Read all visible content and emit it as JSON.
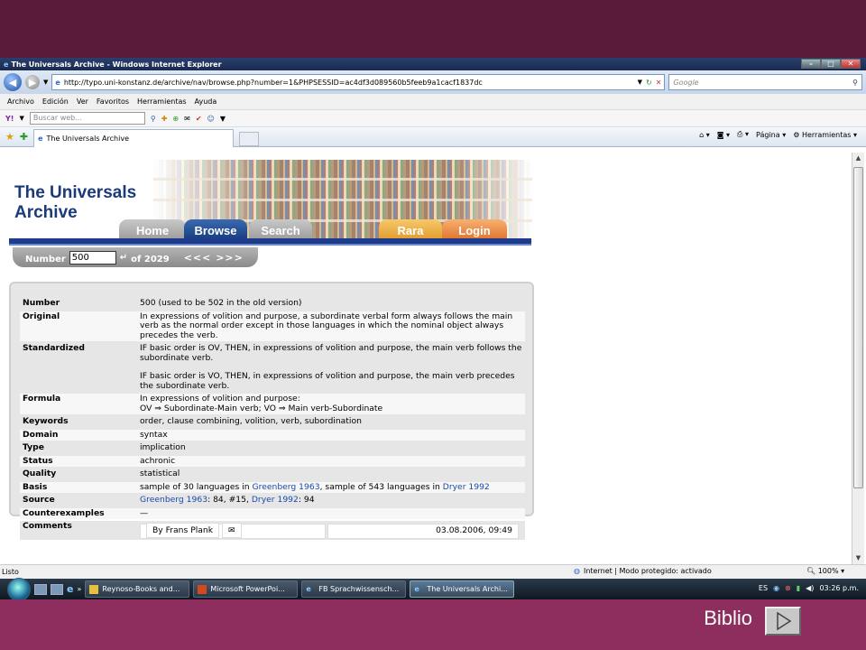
{
  "browser": {
    "window_title": "The Universals Archive - Windows Internet Explorer",
    "url": "http://typo.uni-konstanz.de/archive/nav/browse.php?number=1&PHPSESSID=ac4df3d089560b5feeb9a1cacf1837dc",
    "search_placeholder": "Google",
    "menu": [
      "Archivo",
      "Edición",
      "Ver",
      "Favoritos",
      "Herramientas",
      "Ayuda"
    ],
    "toolbar_search_placeholder": "Buscar web...",
    "tab_title": "The Universals Archive",
    "cmd_page": "Página",
    "cmd_tools": "Herramientas",
    "status_text": "Listo",
    "status_zone": "Internet | Modo protegido: activado",
    "zoom": "100%"
  },
  "site": {
    "title_line1": "The Universals",
    "title_line2": "Archive",
    "nav": [
      "Home",
      "Browse",
      "Search",
      "Rara",
      "Login"
    ],
    "active_tab": "Browse",
    "number_label": "Number",
    "number_value": "500",
    "of_total": "of 2029",
    "nav_arrows": "<<< >>>"
  },
  "record": {
    "number_label": "Number",
    "number": "500 (used to be 502 in the old version)",
    "original_label": "Original",
    "original": "In expressions of volition and purpose, a subordinate verbal form always follows the main verb as the normal order except in those languages in which the nominal object always precedes the verb.",
    "standardized_label": "Standardized",
    "standardized_1": "IF basic order is OV, THEN, in expressions of volition and purpose, the main verb follows the subordinate verb.",
    "standardized_2": "IF basic order is VO, THEN, in expressions of volition and purpose, the main verb precedes the subordinate verb.",
    "formula_label": "Formula",
    "formula_1": "In expressions of volition and purpose:",
    "formula_2": "OV ⇒ Subordinate-Main verb; VO ⇒ Main verb-Subordinate",
    "keywords_label": "Keywords",
    "keywords": "order, clause combining, volition, verb, subordination",
    "domain_label": "Domain",
    "domain": "syntax",
    "type_label": "Type",
    "type": "implication",
    "status_label": "Status",
    "status": "achronic",
    "quality_label": "Quality",
    "quality": "statistical",
    "basis_label": "Basis",
    "basis_a": "sample of 30 languages in ",
    "basis_link1": "Greenberg 1963",
    "basis_b": ", sample of 543 languages in ",
    "basis_link2": "Dryer 1992",
    "source_label": "Source",
    "source_link1": "Greenberg 1963",
    "source_a": ": 84, #15, ",
    "source_link2": "Dryer 1992",
    "source_b": ": 94",
    "counterexamples_label": "Counterexamples",
    "counterexamples": "—",
    "comments_label": "Comments",
    "comment_author": "By Frans Plank",
    "comment_date": "03.08.2006, 09:49"
  },
  "taskbar": {
    "buttons": [
      "Reynoso-Books and...",
      "Microsoft PowerPoi...",
      "FB Sprachwissensch...",
      "The Universals Archi..."
    ],
    "lang": "ES",
    "time": "03:26 p.m."
  },
  "slide": {
    "link_label": "Biblio"
  }
}
